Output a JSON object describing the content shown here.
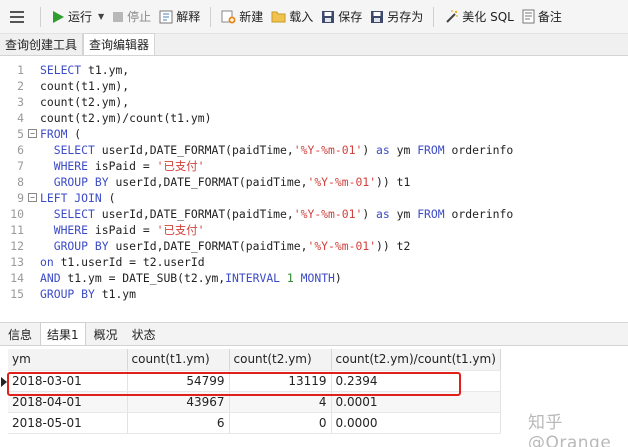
{
  "toolbar": {
    "run_label": "运行",
    "stop_label": "停止",
    "explain_label": "解释",
    "new_label": "新建",
    "load_label": "载入",
    "save_label": "保存",
    "save_as_label": "另存为",
    "beautify_label": "美化 SQL",
    "notes_label": "备注"
  },
  "editor_tabs": [
    "查询创建工具",
    "查询编辑器"
  ],
  "code_lines": [
    [
      "1",
      [
        [
          "kw",
          "SELECT"
        ],
        [
          "tx",
          " t1.ym,"
        ]
      ]
    ],
    [
      "2",
      [
        [
          "tx",
          "count(t1.ym),"
        ]
      ]
    ],
    [
      "3",
      [
        [
          "tx",
          "count(t2.ym),"
        ]
      ]
    ],
    [
      "4",
      [
        [
          "tx",
          "count(t2.ym)/count(t1.ym)"
        ]
      ]
    ],
    [
      "5",
      [
        [
          "kw",
          "FROM"
        ],
        [
          "tx",
          " ("
        ]
      ]
    ],
    [
      "6",
      [
        [
          "tx",
          "  "
        ],
        [
          "kw",
          "SELECT"
        ],
        [
          "tx",
          " userId,DATE_FORMAT(paidTime,"
        ],
        [
          "str",
          "'%Y-%m-01'"
        ],
        [
          "tx",
          ") "
        ],
        [
          "kw",
          "as"
        ],
        [
          "tx",
          " ym "
        ],
        [
          "kw",
          "FROM"
        ],
        [
          "tx",
          " orderinfo"
        ]
      ]
    ],
    [
      "7",
      [
        [
          "tx",
          "  "
        ],
        [
          "kw",
          "WHERE"
        ],
        [
          "tx",
          " isPaid = "
        ],
        [
          "str",
          "'已支付'"
        ]
      ]
    ],
    [
      "8",
      [
        [
          "tx",
          "  "
        ],
        [
          "kw",
          "GROUP BY"
        ],
        [
          "tx",
          " userId,DATE_FORMAT(paidTime,"
        ],
        [
          "str",
          "'%Y-%m-01'"
        ],
        [
          "tx",
          ")) t1"
        ]
      ]
    ],
    [
      "9",
      [
        [
          "kw",
          "LEFT JOIN"
        ],
        [
          "tx",
          " ("
        ]
      ]
    ],
    [
      "10",
      [
        [
          "tx",
          "  "
        ],
        [
          "kw",
          "SELECT"
        ],
        [
          "tx",
          " userId,DATE_FORMAT(paidTime,"
        ],
        [
          "str",
          "'%Y-%m-01'"
        ],
        [
          "tx",
          ") "
        ],
        [
          "kw",
          "as"
        ],
        [
          "tx",
          " ym "
        ],
        [
          "kw",
          "FROM"
        ],
        [
          "tx",
          " orderinfo"
        ]
      ]
    ],
    [
      "11",
      [
        [
          "tx",
          "  "
        ],
        [
          "kw",
          "WHERE"
        ],
        [
          "tx",
          " isPaid = "
        ],
        [
          "str",
          "'已支付'"
        ]
      ]
    ],
    [
      "12",
      [
        [
          "tx",
          "  "
        ],
        [
          "kw",
          "GROUP BY"
        ],
        [
          "tx",
          " userId,DATE_FORMAT(paidTime,"
        ],
        [
          "str",
          "'%Y-%m-01'"
        ],
        [
          "tx",
          ")) t2"
        ]
      ]
    ],
    [
      "13",
      [
        [
          "kw",
          "on"
        ],
        [
          "tx",
          " t1.userId = t2.userId"
        ]
      ]
    ],
    [
      "14",
      [
        [
          "kw",
          "AND"
        ],
        [
          "tx",
          " t1.ym = DATE_SUB(t2.ym,"
        ],
        [
          "kw",
          "INTERVAL"
        ],
        [
          "tx",
          " "
        ],
        [
          "num",
          "1"
        ],
        [
          "tx",
          " "
        ],
        [
          "kw",
          "MONTH"
        ],
        [
          "tx",
          ")"
        ]
      ]
    ],
    [
      "15",
      [
        [
          "kw",
          "GROUP BY"
        ],
        [
          "tx",
          " t1.ym"
        ]
      ]
    ]
  ],
  "fold_lines": [
    "5",
    "9"
  ],
  "result_tabs": [
    "信息",
    "结果1",
    "概况",
    "状态"
  ],
  "results": {
    "columns": [
      "ym",
      "count(t1.ym)",
      "count(t2.ym)",
      "count(t2.ym)/count(t1.ym)"
    ],
    "rows": [
      [
        "2018-03-01",
        "54799",
        "13119",
        "0.2394"
      ],
      [
        "2018-04-01",
        "43967",
        "4",
        "0.0001"
      ],
      [
        "2018-05-01",
        "6",
        "0",
        "0.0000"
      ]
    ]
  },
  "watermark": "知乎 @Orange",
  "colors": {
    "keyword": "#3c4bc6",
    "string": "#d1413c",
    "number": "#2c8b2c",
    "highlight": "#e0201a",
    "run_icon": "#2e9e2e"
  }
}
